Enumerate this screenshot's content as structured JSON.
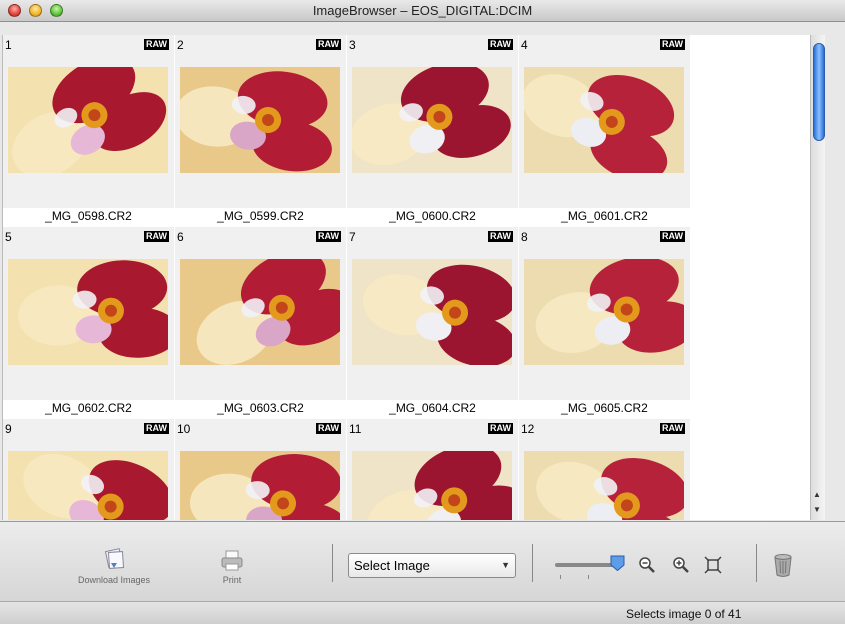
{
  "window": {
    "title": "ImageBrowser – EOS_DIGITAL:DCIM"
  },
  "images": [
    {
      "index": "1",
      "raw": "RAW",
      "filename": "_MG_0598.CR2"
    },
    {
      "index": "2",
      "raw": "RAW",
      "filename": "_MG_0599.CR2"
    },
    {
      "index": "3",
      "raw": "RAW",
      "filename": "_MG_0600.CR2"
    },
    {
      "index": "4",
      "raw": "RAW",
      "filename": "_MG_0601.CR2"
    },
    {
      "index": "5",
      "raw": "RAW",
      "filename": "_MG_0602.CR2"
    },
    {
      "index": "6",
      "raw": "RAW",
      "filename": "_MG_0603.CR2"
    },
    {
      "index": "7",
      "raw": "RAW",
      "filename": "_MG_0604.CR2"
    },
    {
      "index": "8",
      "raw": "RAW",
      "filename": "_MG_0605.CR2"
    },
    {
      "index": "9",
      "raw": "RAW",
      "filename": ""
    },
    {
      "index": "10",
      "raw": "RAW",
      "filename": ""
    },
    {
      "index": "11",
      "raw": "RAW",
      "filename": ""
    },
    {
      "index": "12",
      "raw": "RAW",
      "filename": ""
    }
  ],
  "toolbar": {
    "download_label": "Download Images",
    "print_label": "Print",
    "select_value": "Select Image"
  },
  "status": {
    "text": "Selects image 0 of 41"
  },
  "colors": {
    "accent": "#2a6fd8",
    "flower_red": "#a8182e",
    "petal_cream": "#f3e2b0"
  }
}
